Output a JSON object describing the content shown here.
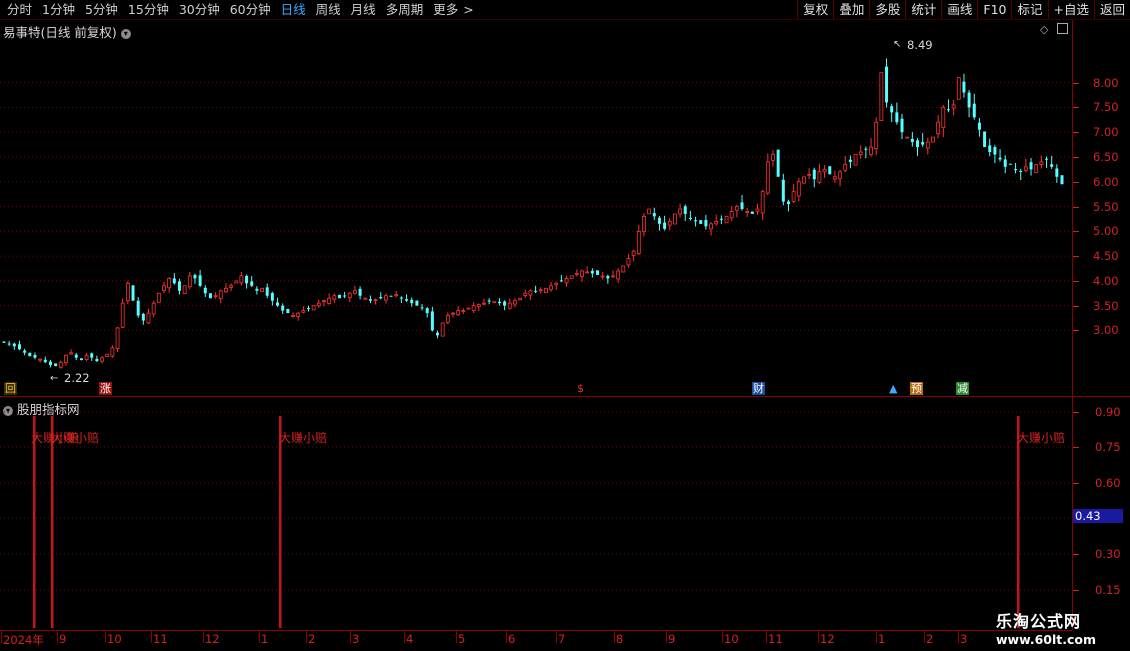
{
  "toolbar": {
    "periods": [
      "分时",
      "1分钟",
      "5分钟",
      "15分钟",
      "30分钟",
      "60分钟",
      "日线",
      "周线",
      "月线",
      "多周期",
      "更多"
    ],
    "more_arrow": ">",
    "active_period": "日线",
    "right_buttons": [
      "复权",
      "叠加",
      "多股",
      "统计",
      "画线",
      "F10",
      "标记",
      "+自选",
      "返回"
    ]
  },
  "main": {
    "title": "易事特(日线 前复权)",
    "high_label": "8.49",
    "low_label": "2.22",
    "price_ticks": [
      "8.00",
      "7.50",
      "7.00",
      "6.50",
      "6.00",
      "5.50",
      "5.00",
      "4.50",
      "4.00",
      "3.50",
      "3.00"
    ],
    "event_badges": [
      {
        "text": "回",
        "color": "#e8c23a",
        "bg": "#3a2a00"
      },
      {
        "text": "涨",
        "color": "#ffffff",
        "bg": "#9a1010"
      },
      {
        "text": "$",
        "color": "#e03030",
        "bg": "#000000"
      },
      {
        "text": "财",
        "color": "#ffffff",
        "bg": "#1b4fa0"
      },
      {
        "text": "▲",
        "color": "#3fa9ff",
        "bg": "#000000"
      },
      {
        "text": "预",
        "color": "#ffffff",
        "bg": "#b86a10"
      },
      {
        "text": "减",
        "color": "#ffffff",
        "bg": "#2a8a2a"
      }
    ],
    "colors": {
      "up": "#ff3232",
      "down": "#54ffff",
      "grid": "#7a0000"
    }
  },
  "indicator": {
    "title": "股朋指标网",
    "value_ticks": [
      "0.90",
      "0.75",
      "0.60",
      "0.30",
      "0.15"
    ],
    "current_value": "0.43",
    "signal_labels": [
      "大赚小赔",
      "大赚小赔",
      "大赚小赔",
      "大赚小赔"
    ]
  },
  "date_axis": {
    "labels": [
      "2024年",
      "9",
      "10",
      "11",
      "12",
      "1",
      "2",
      "3",
      "4",
      "5",
      "6",
      "7",
      "8",
      "9",
      "10",
      "11",
      "12",
      "1",
      "2",
      "3"
    ]
  },
  "watermark": {
    "line1": "乐淘公式网",
    "line2": "www.60lt.com"
  },
  "chart_data": {
    "type": "candlestick",
    "title": "易事特(日线 前复权)",
    "x_start": "2024年",
    "ylim": [
      2.0,
      8.9
    ],
    "closes": [
      2.75,
      2.72,
      2.68,
      2.62,
      2.55,
      2.48,
      2.45,
      2.42,
      2.36,
      2.3,
      2.28,
      2.35,
      2.5,
      2.55,
      2.45,
      2.4,
      2.5,
      2.45,
      2.38,
      2.45,
      2.52,
      2.65,
      3.05,
      3.55,
      3.95,
      3.6,
      3.3,
      3.2,
      3.35,
      3.55,
      3.75,
      3.9,
      4.05,
      3.95,
      3.8,
      3.9,
      4.1,
      4.05,
      3.9,
      3.75,
      3.65,
      3.7,
      3.8,
      3.85,
      3.9,
      4.0,
      4.1,
      3.95,
      3.9,
      3.8,
      3.85,
      3.7,
      3.6,
      3.5,
      3.4,
      3.35,
      3.3,
      3.35,
      3.4,
      3.45,
      3.5,
      3.55,
      3.6,
      3.65,
      3.7,
      3.65,
      3.7,
      3.75,
      3.8,
      3.7,
      3.65,
      3.6,
      3.62,
      3.65,
      3.7,
      3.68,
      3.72,
      3.65,
      3.6,
      3.55,
      3.5,
      3.45,
      3.35,
      3.0,
      2.9,
      3.15,
      3.3,
      3.35,
      3.4,
      3.4,
      3.45,
      3.5,
      3.52,
      3.55,
      3.6,
      3.58,
      3.55,
      3.5,
      3.55,
      3.6,
      3.65,
      3.75,
      3.8,
      3.78,
      3.82,
      3.85,
      3.9,
      3.95,
      4.0,
      4.05,
      4.1,
      4.15,
      4.2,
      4.18,
      4.15,
      4.12,
      4.1,
      4.05,
      4.1,
      4.2,
      4.3,
      4.45,
      4.6,
      5.0,
      5.3,
      5.45,
      5.3,
      5.15,
      5.05,
      5.2,
      5.35,
      5.45,
      5.35,
      5.25,
      5.2,
      5.15,
      5.1,
      5.15,
      5.2,
      5.25,
      5.3,
      5.4,
      5.5,
      5.45,
      5.4,
      5.35,
      5.45,
      5.8,
      6.4,
      6.55,
      6.1,
      5.6,
      5.55,
      5.8,
      6.0,
      6.1,
      6.15,
      6.05,
      6.2,
      6.25,
      6.15,
      6.1,
      6.2,
      6.35,
      6.4,
      6.55,
      6.6,
      6.65,
      6.7,
      7.2,
      8.2,
      7.6,
      7.4,
      7.2,
      7.0,
      6.9,
      6.8,
      6.7,
      6.75,
      6.8,
      6.9,
      7.2,
      7.5,
      7.45,
      7.55,
      8.1,
      7.8,
      7.5,
      7.3,
      7.05,
      6.7,
      6.6,
      6.55,
      6.45,
      6.3,
      6.35,
      6.25,
      6.2,
      6.3,
      6.25,
      6.35,
      6.4,
      6.45,
      6.3,
      6.1,
      5.95
    ]
  }
}
